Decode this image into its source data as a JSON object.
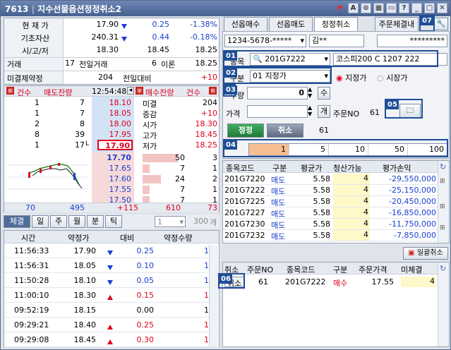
{
  "window": {
    "title_code": "7613",
    "title": "지수선물옵션정정취소2",
    "icons": [
      "bookmark-red-icon",
      "font-icon",
      "link-icon",
      "layout-icon",
      "window-icon",
      "help-icon",
      "minimize-icon",
      "maximize-icon",
      "close-icon"
    ]
  },
  "quote": {
    "rows": [
      {
        "label": "현 재 가",
        "value": "17.90",
        "change": "0.25",
        "pct": "-1.38%"
      },
      {
        "label": "기초자산",
        "value": "240.31",
        "change": "0.44",
        "pct": "-0.18%"
      }
    ],
    "oh_label": "시/고/저",
    "open": "18.30",
    "high": "18.45",
    "low": "18.25",
    "volume_label": "거래",
    "volume": "17",
    "prev_volume_label": "전일거래",
    "prev_volume": "6",
    "theory_label": "이론",
    "theory": "18.25",
    "oi_label": "미결제약정",
    "oi": "204",
    "prev_diff_label": "전일대비",
    "prev_diff": "+10"
  },
  "orderbook": {
    "left_header": [
      "건수",
      "매도잔량"
    ],
    "time": "12:54:48",
    "right_header": [
      "매수잔량",
      "건수"
    ],
    "asks": [
      {
        "count": "1",
        "qty": "7",
        "price": "18.10"
      },
      {
        "count": "1",
        "qty": "7",
        "price": "18.05"
      },
      {
        "count": "2",
        "qty": "8",
        "price": "18.00"
      },
      {
        "count": "8",
        "qty": "39",
        "price": "17.95"
      },
      {
        "count": "1",
        "qty": "17",
        "price": "17.90",
        "marker": "L"
      }
    ],
    "info": [
      {
        "label": "미결",
        "value": "204"
      },
      {
        "label": "증감",
        "value": "+10"
      },
      {
        "label": "시가",
        "value": "18.30"
      },
      {
        "label": "고가",
        "value": "18.45"
      },
      {
        "label": "저가",
        "value": "18.25"
      }
    ],
    "bids": [
      {
        "price": "17.70",
        "qty": "50",
        "count": "3"
      },
      {
        "price": "17.65",
        "qty": "7",
        "count": "1"
      },
      {
        "price": "17.60",
        "qty": "24",
        "count": "2"
      },
      {
        "price": "17.55",
        "qty": "7",
        "count": "1"
      },
      {
        "price": "17.50",
        "qty": "7",
        "count": "1"
      }
    ],
    "totals": {
      "ask_count": "70",
      "ask_qty": "495",
      "diff": "+115",
      "bid_qty": "610",
      "bid_count": "73"
    }
  },
  "trade_tabs": {
    "items": [
      "체결",
      "일",
      "주",
      "월",
      "분",
      "틱"
    ],
    "active": "체결",
    "interval": "1",
    "count": "300",
    "count_unit": "개"
  },
  "trades": {
    "headers": [
      "시간",
      "약정가",
      "대비",
      "약정수량"
    ],
    "rows": [
      {
        "time": "11:56:33",
        "price": "17.90",
        "dir": "down",
        "diff": "0.25",
        "qty": "1"
      },
      {
        "time": "11:56:31",
        "price": "18.05",
        "dir": "down",
        "diff": "0.10",
        "qty": "1"
      },
      {
        "time": "11:50:28",
        "price": "18.10",
        "dir": "down",
        "diff": "0.05",
        "qty": "1"
      },
      {
        "time": "11:00:10",
        "price": "18.30",
        "dir": "up",
        "diff": "0.15",
        "qty": "1"
      },
      {
        "time": "09:52:19",
        "price": "18.15",
        "dir": "flat",
        "diff": "0.00",
        "qty": "1"
      },
      {
        "time": "09:29:21",
        "price": "18.40",
        "dir": "up",
        "diff": "0.25",
        "qty": "1"
      },
      {
        "time": "09:29:08",
        "price": "18.45",
        "dir": "up",
        "diff": "0.30",
        "qty": "1"
      }
    ]
  },
  "order": {
    "tabs": [
      "선옵매수",
      "선옵매도",
      "정정취소",
      "주문체결내"
    ],
    "active_tab": "정정취소",
    "account": "1234-5678-*****",
    "name": "김**",
    "password": "*********",
    "symbol_label": "종목",
    "symbol_code": "201G7222",
    "symbol_name": "코스피200 C 1207 222",
    "type_label": "구분",
    "type_value": "01 지정가",
    "radio_limit": "지정가",
    "radio_market": "시장가",
    "qty_label": "수량",
    "qty_value": "0",
    "qty_btn": "수",
    "price_label": "가격",
    "price_btn": "개",
    "order_no_label": "주문NO",
    "order_no": "61",
    "correct_btn": "정정",
    "cancel_btn": "취소",
    "cancel_no": "61",
    "qty_presets": [
      "1",
      "5",
      "10",
      "50",
      "100"
    ]
  },
  "badges": [
    "01",
    "02",
    "03",
    "04",
    "05",
    "06",
    "07"
  ],
  "balance": {
    "headers": [
      "종목코드",
      "구분",
      "평균가",
      "청산가능",
      "평가손익"
    ],
    "rows": [
      {
        "code": "201G7220",
        "side": "매도",
        "avg": "5.58",
        "avail": "4",
        "pnl": "-29,550,000"
      },
      {
        "code": "201G7222",
        "side": "매도",
        "avg": "5.58",
        "avail": "4",
        "pnl": "-25,150,000"
      },
      {
        "code": "201G7225",
        "side": "매도",
        "avg": "5.58",
        "avail": "4",
        "pnl": "-20,450,000"
      },
      {
        "code": "201G7227",
        "side": "매도",
        "avg": "5.58",
        "avail": "4",
        "pnl": "-16,850,000"
      },
      {
        "code": "201G7230",
        "side": "매도",
        "avg": "5.58",
        "avail": "4",
        "pnl": "-11,750,000"
      },
      {
        "code": "201G7232",
        "side": "매도",
        "avg": "5.58",
        "avail": "4",
        "pnl": "-7,850,000"
      }
    ]
  },
  "bulk_cancel": "일괄취소",
  "pending": {
    "headers": [
      "취소",
      "주문NO",
      "종목코드",
      "구분",
      "주문가격",
      "미체결"
    ],
    "rows": [
      {
        "cancel": "취소",
        "no": "61",
        "code": "201G7222",
        "side": "매수",
        "price": "17.55",
        "qty": "4"
      }
    ]
  }
}
